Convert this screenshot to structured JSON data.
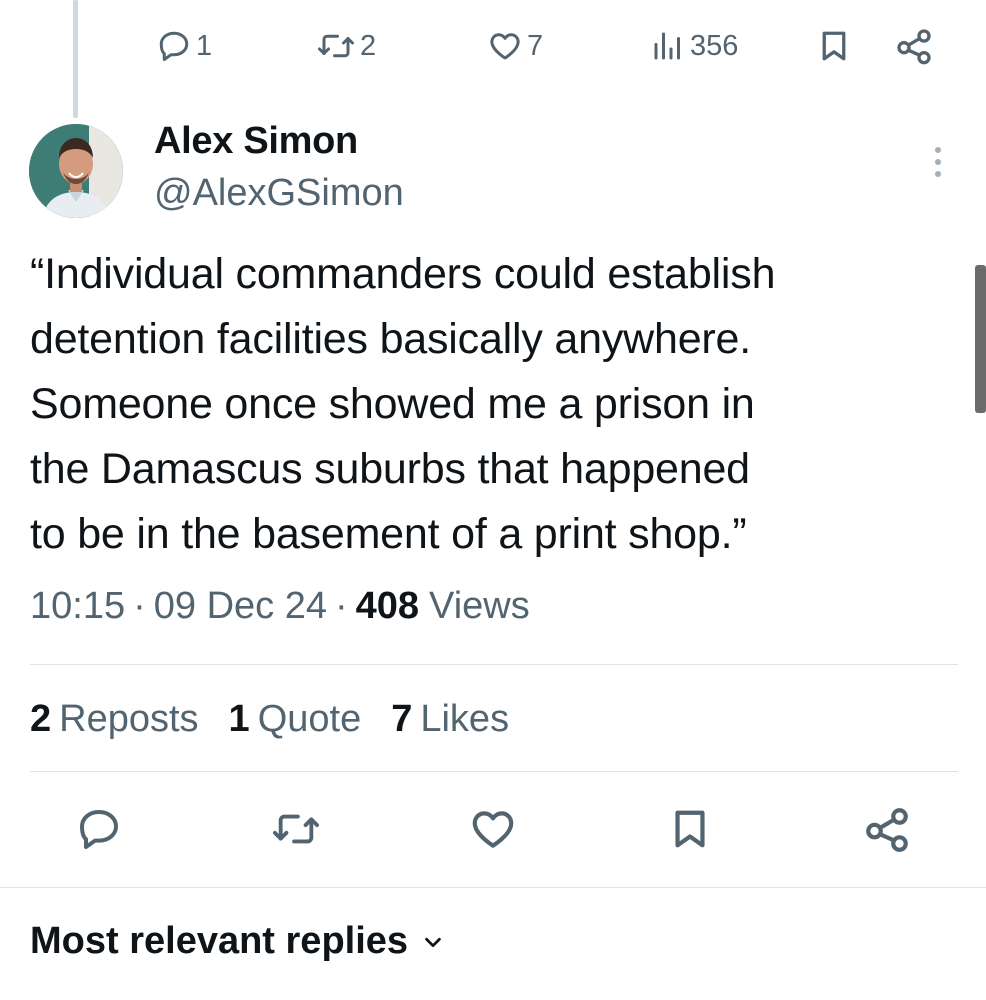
{
  "parent_tweet": {
    "actions": {
      "reply_count": "1",
      "repost_count": "2",
      "like_count": "7",
      "view_count": "356"
    }
  },
  "tweet": {
    "author": {
      "display_name": "Alex Simon",
      "handle": "@AlexGSimon"
    },
    "text": "“Individual commanders could establish\ndetention facilities basically anywhere.\nSomeone once showed me a prison in\nthe Damascus suburbs that happened\nto be in the basement of a print shop.”",
    "time": "10:15",
    "date": "09 Dec 24",
    "views_count": "408",
    "views_label": "Views",
    "separator": "·"
  },
  "stats": {
    "reposts_count": "2",
    "reposts_label": "Reposts",
    "quotes_count": "1",
    "quotes_label": "Quote",
    "likes_count": "7",
    "likes_label": "Likes"
  },
  "replies": {
    "sort_label": "Most relevant replies"
  },
  "icons": {
    "reply": "reply-icon",
    "repost": "repost-icon",
    "like": "like-icon",
    "views": "views-icon",
    "bookmark": "bookmark-icon",
    "share": "share-icon",
    "more": "more-icon",
    "chevron": "chevron-down-icon"
  },
  "colors": {
    "text": "#0f1419",
    "secondary": "#536471",
    "divider": "#dde3e7"
  }
}
